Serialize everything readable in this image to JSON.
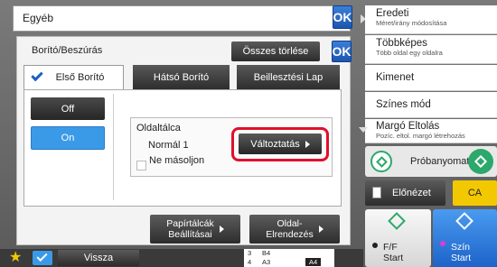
{
  "top": {
    "title": "Egyéb",
    "ok_label": "OK"
  },
  "dialog": {
    "title": "Borító/Beszúrás",
    "clear_all_label": "Összes törlése",
    "ok_label": "OK"
  },
  "tabs": [
    {
      "label": "Első Borító",
      "active": true
    },
    {
      "label": "Hátsó Borító",
      "active": false
    },
    {
      "label": "Beillesztési Lap",
      "active": false
    }
  ],
  "toggle": {
    "off_label": "Off",
    "on_label": "On",
    "selected": "On"
  },
  "tray": {
    "line1": "Oldaltálca",
    "line2": "Normál 1",
    "change_label": "Változtatás",
    "no_copy_label": "Ne másoljon"
  },
  "bottom_buttons": {
    "paper_tray_settings": "Papírtálcák\nBeállításai",
    "page_layout": "Oldal-\nElrendezés"
  },
  "right_menu": [
    {
      "title": "Eredeti",
      "sub": "Méret/irány módosítása"
    },
    {
      "title": "Többképes",
      "sub": "Több oldal egy oldalra"
    },
    {
      "title": "Kimenet",
      "sub": ""
    },
    {
      "title": "Színes mód",
      "sub": ""
    },
    {
      "title": "Margó Eltolás",
      "sub": "Pozíc. eltol. margó létrehozás"
    }
  ],
  "preview_copy_label": "Próbanyomat",
  "preview_label": "Előnézet",
  "ca_label": "CA",
  "bw_start": {
    "line1": "F/F",
    "line2": "Start"
  },
  "color_start": {
    "line1": "Szín",
    "line2": "Start"
  },
  "back_label": "Vissza",
  "tray_status": [
    {
      "num": "3",
      "size": "B4"
    },
    {
      "num": "4",
      "size": "A3"
    }
  ],
  "paper_size": "A4",
  "colors": {
    "accent_blue": "#1d5fc0",
    "highlight_red": "#e0102a",
    "ca_yellow": "#f2c800",
    "active_blue": "#3b9ae8"
  }
}
